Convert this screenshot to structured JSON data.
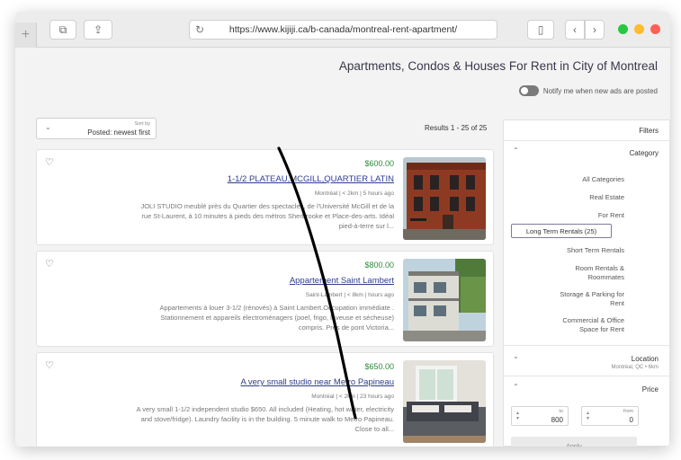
{
  "browser": {
    "url": "https://www.kijiji.ca/b-canada/montreal-rent-apartment/"
  },
  "page": {
    "title": "Apartments, Condos & Houses For Rent in City of Montreal",
    "notify_label": "Notify me when new ads are posted",
    "sort_small_label": "Sort by",
    "sort_value": "Posted: newest first",
    "results_text": "Results 1 - 25 of 25"
  },
  "listings": [
    {
      "price": "$600.00",
      "title": "1-1/2 PLATEAU,MCGILL,QUARTIER LATIN",
      "meta": "Montréal  |  < 2km  |  5 hours ago",
      "desc": "JOLI STUDIO meublé près du Quartier des spectacles, de l'Université McGill et de la rue St-Laurent, à 10 minutes à pieds des métros Sherbrooke et Place-des-arts. Idéal pied-à-terre sur l..."
    },
    {
      "price": "$800.00",
      "title": "Appartement Saint Lambert",
      "meta": "Saint-Lambert  |  < 8km  |  hours ago",
      "desc": "Appartements à louer 3-1/2 (rénovés) à Saint Lambert.Occupation immédiate . Stationnement et appareils électroménagers (poel, frigo, laveuse et sécheuse) compris. Près de pont Victoria..."
    },
    {
      "price": "$650.00",
      "title": "A very small studio near Metro Papineau",
      "meta": "Montréal  |  < 2km  |  23 hours ago",
      "desc": "A very small 1-1/2 independent studio $650. All included (Heating, hot water, electricity and stove/fridge). Laundry facility is in the building. 5 minute walk to Metro Papineau. Close to all..."
    }
  ],
  "filters": {
    "heading": "Filters",
    "category_heading": "Category",
    "categories": [
      "All Categories",
      "Real Estate",
      "For Rent",
      "Long Term Rentals (25)",
      "Short Term Rentals",
      "Room Rentals & Roommates",
      "Storage & Parking for Rent",
      "Commercial & Office Space for Rent"
    ],
    "location_heading": "Location",
    "location_sub": "Montréal, QC • 6km",
    "price_heading": "Price",
    "price_from_label": "from",
    "price_from_value": "0",
    "price_to_label": "to",
    "price_to_value": "800",
    "apply_label": "Apply"
  }
}
